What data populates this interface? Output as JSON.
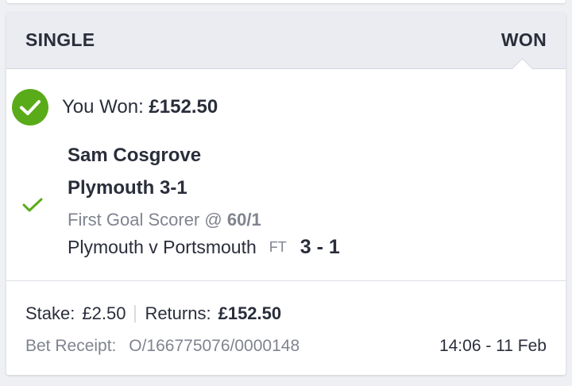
{
  "bet": {
    "type": "SINGLE",
    "status": "WON",
    "won_label": "You Won:",
    "won_amount": "£152.50",
    "selection": {
      "name": "Sam Cosgrove",
      "result": "Plymouth 3-1",
      "market": "First Goal Scorer",
      "odds_prefix": "@",
      "odds": "60/1",
      "event": "Plymouth v Portsmouth",
      "event_status": "FT",
      "score": "3 - 1"
    },
    "stake_label": "Stake:",
    "stake_value": "£2.50",
    "returns_label": "Returns:",
    "returns_value": "£152.50",
    "receipt_label": "Bet Receipt:",
    "receipt_value": "O/166775076/0000148",
    "timestamp": "14:06 - 11 Feb"
  },
  "colors": {
    "win_green": "#5aab19",
    "header_bg": "#ebecf1",
    "text_dark": "#2a2e3b",
    "text_muted": "#80848f"
  },
  "icons": {
    "won": "check-circle-icon",
    "selection": "check-icon"
  }
}
